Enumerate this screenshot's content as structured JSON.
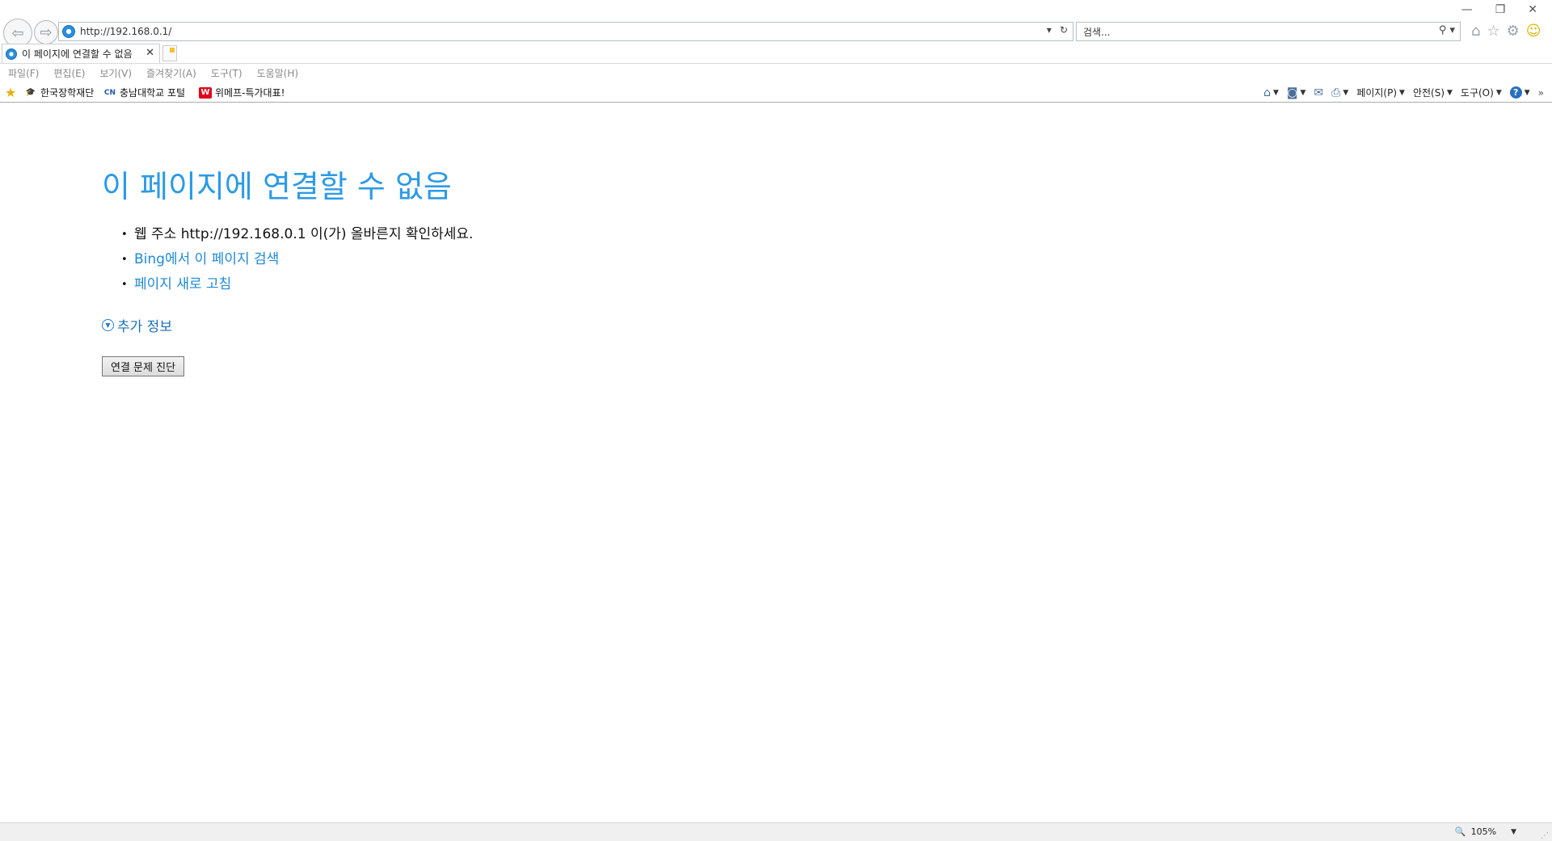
{
  "browser": {
    "address_url": "http://192.168.0.1/",
    "search_placeholder": "검색...",
    "tab_title": "이 페이지에 연결할 수 없음",
    "menu": [
      "파일(F)",
      "편집(E)",
      "보기(V)",
      "즐겨찾기(A)",
      "도구(T)",
      "도움말(H)"
    ],
    "favorites": [
      {
        "label": "한국장학재단",
        "icon": "scholarship-icon"
      },
      {
        "label": "충남대학교 포털",
        "icon": "cnu-icon"
      },
      {
        "label": "위메프-특가대표!",
        "icon": "wemakeprice-icon"
      }
    ],
    "command_bar": {
      "page": "페이지(P)",
      "safety": "안전(S)",
      "tools": "도구(O)"
    },
    "zoom": "105%"
  },
  "page": {
    "title": "이 페이지에 연결할 수 없음",
    "bullet_address": "웹 주소 http://192.168.0.1 이(가) 올바른지 확인하세요.",
    "bullet_bing": "Bing에서 이 페이지 검색",
    "bullet_refresh": "페이지 새로 고침",
    "more_info": "추가 정보",
    "diagnose_button": "연결 문제 진단"
  },
  "colors": {
    "title_blue": "#2d9ae6",
    "link_blue": "#1e88d8"
  }
}
